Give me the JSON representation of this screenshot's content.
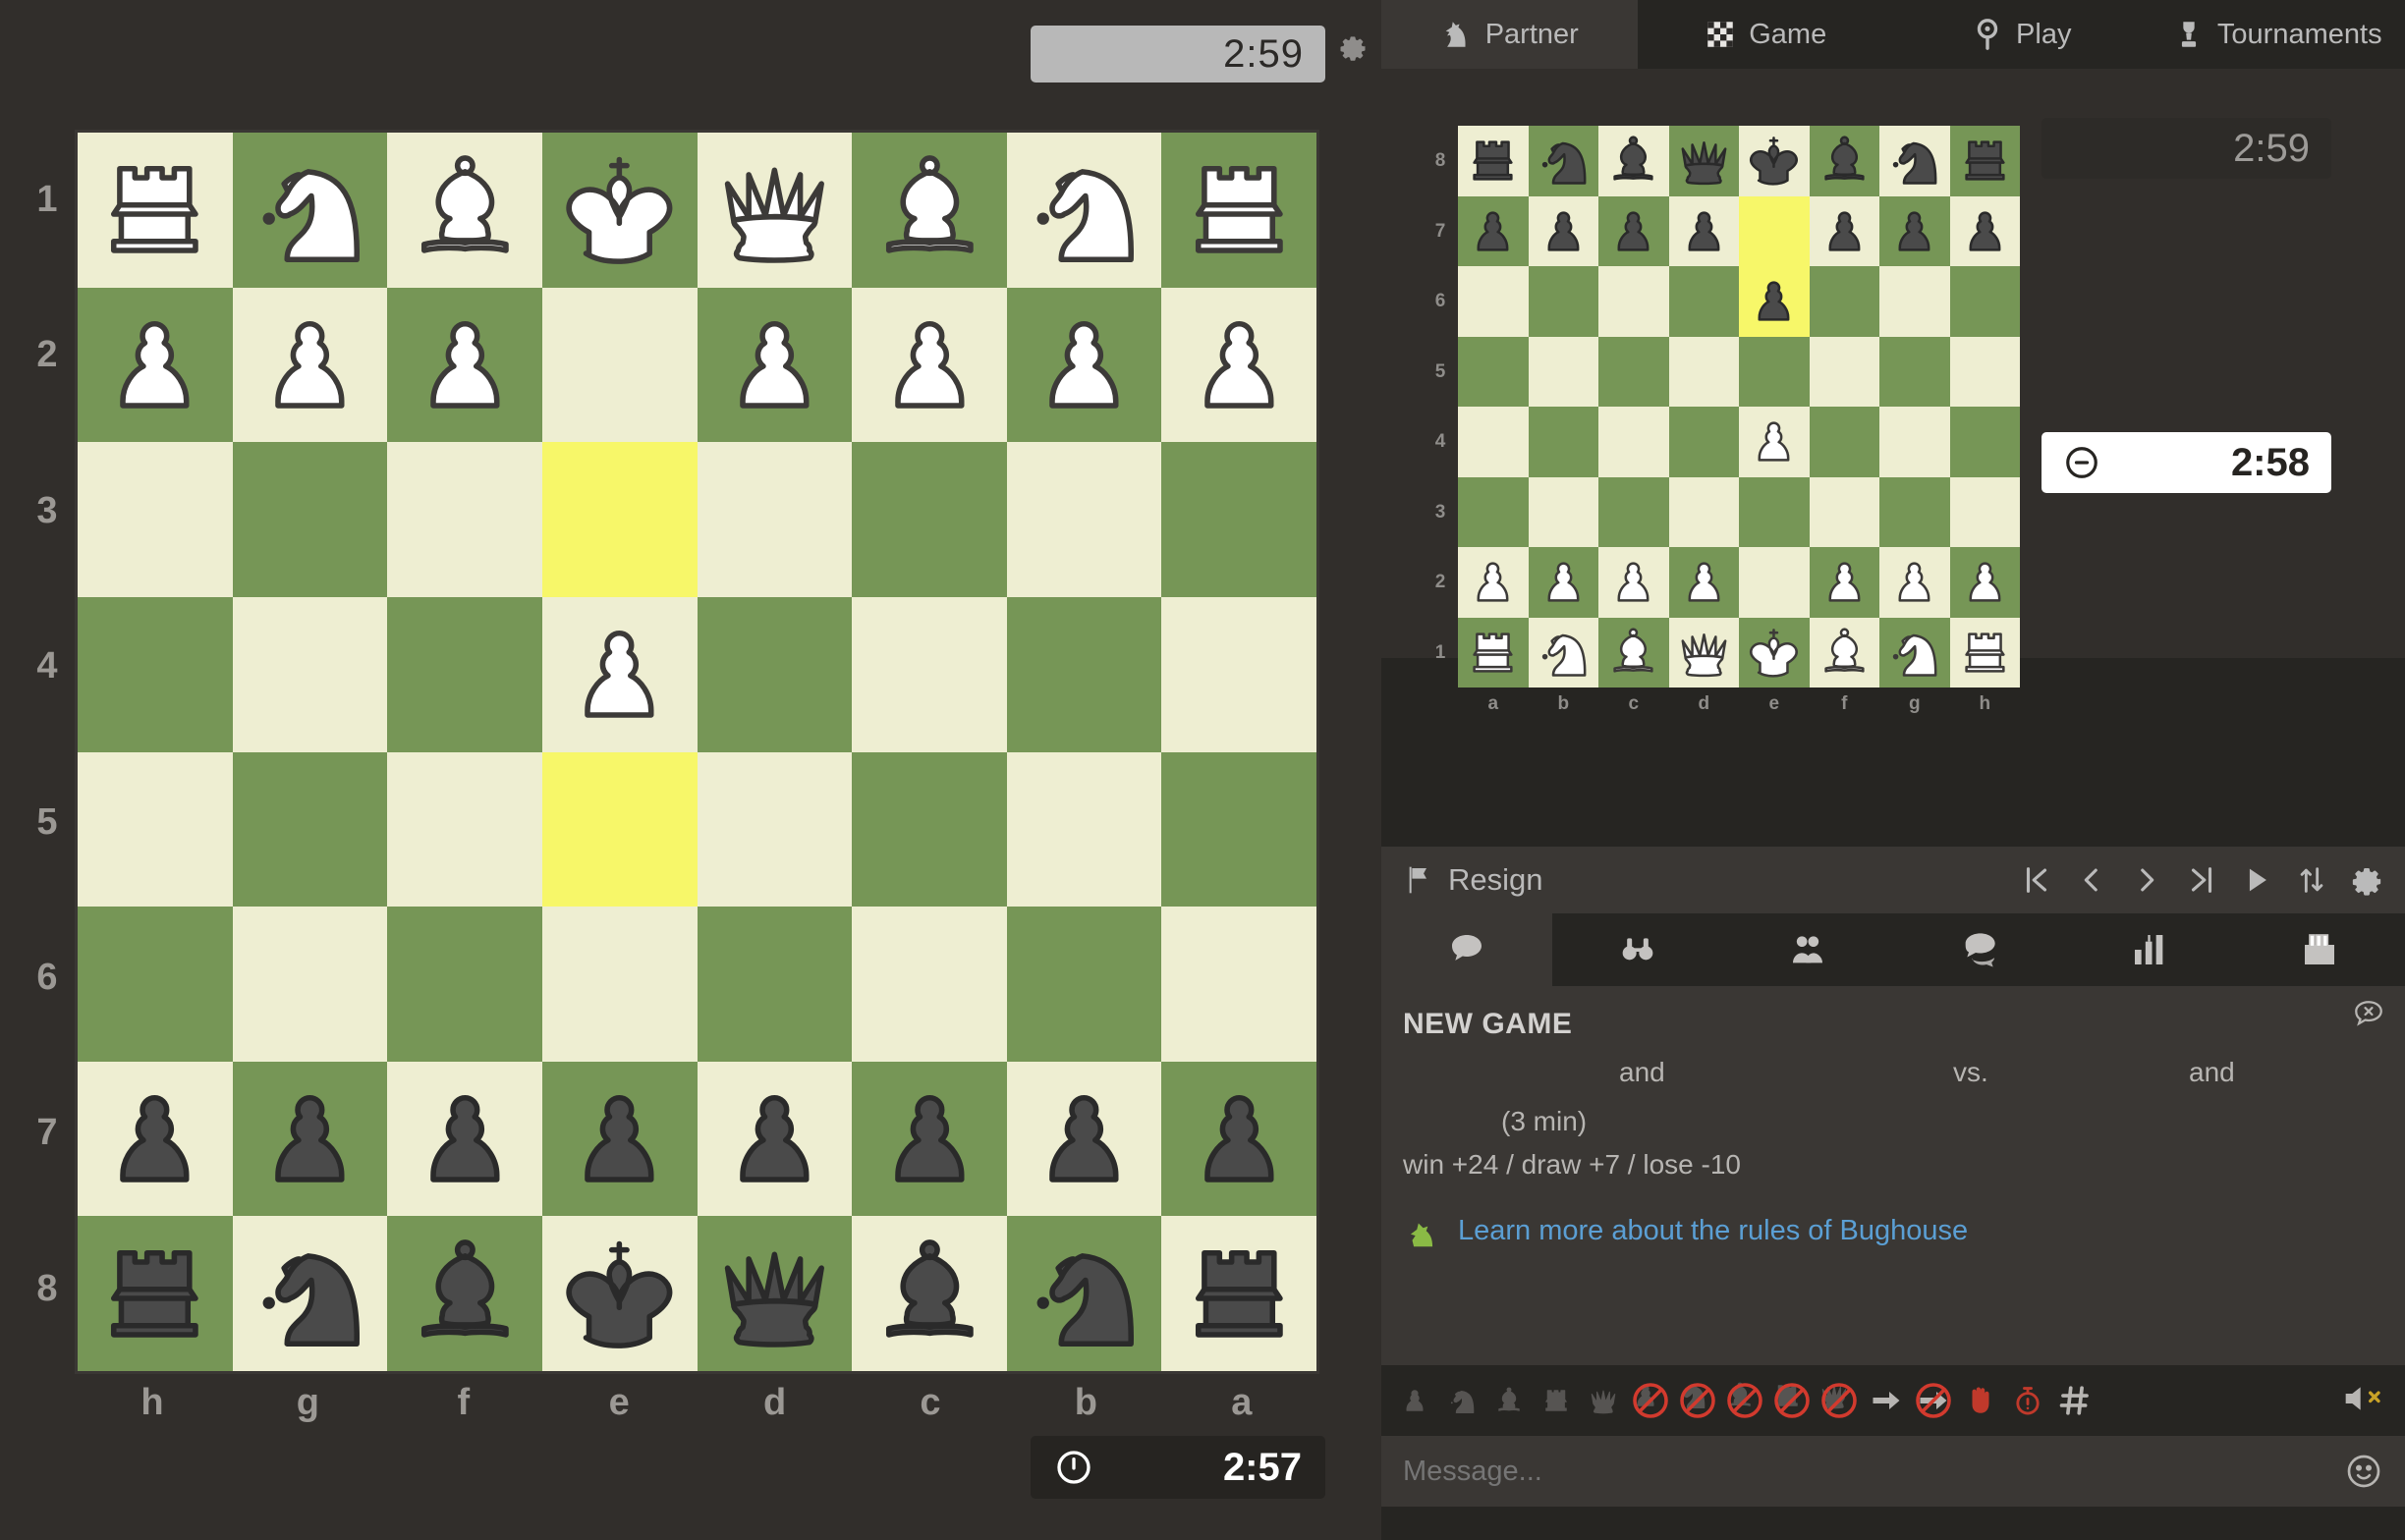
{
  "board": {
    "top_clock": "2:59",
    "bottom_clock": "2:57",
    "gear_icon": "gear-icon",
    "clock_icon": "clock-icon",
    "flipped": true,
    "rank_labels": [
      "1",
      "2",
      "3",
      "4",
      "5",
      "6",
      "7",
      "8"
    ],
    "file_labels": [
      "h",
      "g",
      "f",
      "e",
      "d",
      "c",
      "b",
      "a"
    ],
    "highlight_squares": [
      "r2c3",
      "r4c3"
    ],
    "rows": [
      [
        "wR",
        "wN",
        "wB",
        "wK",
        "wQ",
        "wB",
        "wN",
        "wR"
      ],
      [
        "wP",
        "wP",
        "wP",
        "",
        "wP",
        "wP",
        "wP",
        "wP"
      ],
      [
        "",
        "",
        "",
        "",
        "",
        "",
        "",
        ""
      ],
      [
        "",
        "",
        "",
        "wP",
        "",
        "",
        "",
        ""
      ],
      [
        "",
        "",
        "",
        "",
        "",
        "",
        "",
        ""
      ],
      [
        "",
        "",
        "",
        "",
        "",
        "",
        "",
        ""
      ],
      [
        "bP",
        "bP",
        "bP",
        "bP",
        "bP",
        "bP",
        "bP",
        "bP"
      ],
      [
        "bR",
        "bN",
        "bB",
        "bK",
        "bQ",
        "bB",
        "bN",
        "bR"
      ]
    ]
  },
  "tabs": [
    {
      "label": "Partner",
      "icon": "horse-head-icon",
      "active": true
    },
    {
      "label": "Game",
      "icon": "checkerboard-icon",
      "active": false
    },
    {
      "label": "Play",
      "icon": "play-pawn-icon",
      "active": false
    },
    {
      "label": "Tournaments",
      "icon": "trophy-icon",
      "active": false
    }
  ],
  "mini_board": {
    "top_clock": "2:59",
    "bottom_clock": "2:58",
    "bottom_clock_icon": "clock-minus-icon",
    "rank_labels": [
      "8",
      "7",
      "6",
      "5",
      "4",
      "3",
      "2",
      "1"
    ],
    "file_labels": [
      "a",
      "b",
      "c",
      "d",
      "e",
      "f",
      "g",
      "h"
    ],
    "highlight_squares": [
      "r1c4",
      "r2c4"
    ],
    "rows": [
      [
        "bR",
        "bN",
        "bB",
        "bQ",
        "bK",
        "bB",
        "bN",
        "bR"
      ],
      [
        "bP",
        "bP",
        "bP",
        "bP",
        "",
        "bP",
        "bP",
        "bP"
      ],
      [
        "",
        "",
        "",
        "",
        "bP",
        "",
        "",
        ""
      ],
      [
        "",
        "",
        "",
        "",
        "",
        "",
        "",
        ""
      ],
      [
        "",
        "",
        "",
        "",
        "wP",
        "",
        "",
        ""
      ],
      [
        "",
        "",
        "",
        "",
        "",
        "",
        "",
        ""
      ],
      [
        "wP",
        "wP",
        "wP",
        "wP",
        "",
        "wP",
        "wP",
        "wP"
      ],
      [
        "wR",
        "wN",
        "wB",
        "wQ",
        "wK",
        "wB",
        "wN",
        "wR"
      ]
    ]
  },
  "resign_bar": {
    "label": "Resign",
    "flag_icon": "flag-icon",
    "controls": [
      {
        "name": "first-move-button",
        "icon": "skip-to-start-icon"
      },
      {
        "name": "previous-move-button",
        "icon": "chevron-left-icon"
      },
      {
        "name": "next-move-button",
        "icon": "chevron-right-icon"
      },
      {
        "name": "last-move-button",
        "icon": "skip-to-end-icon"
      },
      {
        "name": "autoplay-button",
        "icon": "play-icon"
      },
      {
        "name": "flip-board-button",
        "icon": "flip-arrows-icon"
      },
      {
        "name": "settings-button",
        "icon": "gear-icon"
      }
    ]
  },
  "chat_tabs": [
    {
      "name": "chat-tab",
      "icon": "speech-bubble-icon",
      "active": true
    },
    {
      "name": "watchers-tab",
      "icon": "binoculars-icon",
      "active": false
    },
    {
      "name": "players-tab",
      "icon": "people-icon",
      "active": false
    },
    {
      "name": "messages-tab",
      "icon": "chat-bubbles-icon",
      "active": false
    },
    {
      "name": "stats-tab",
      "icon": "bar-chart-icon",
      "active": false
    },
    {
      "name": "archive-tab",
      "icon": "card-box-icon",
      "active": false
    }
  ],
  "chat": {
    "close_icon": "close-bubble-icon",
    "new_game_title": "NEW GAME",
    "player_and_1": "and",
    "player_vs": "vs.",
    "player_and_2": "and",
    "time_control": "(3 min)",
    "rating_change": "win +24 / draw +7 / lose -10",
    "bughouse_icon": "bughouse-knight-icon",
    "bughouse_link": "Learn more about the rules of Bughouse"
  },
  "emoji_bar": {
    "buttons": [
      {
        "name": "pawn-emoji",
        "icon": "pawn-icon"
      },
      {
        "name": "knight-emoji",
        "icon": "knight-icon"
      },
      {
        "name": "bishop-emoji",
        "icon": "bishop-icon"
      },
      {
        "name": "rook-emoji",
        "icon": "rook-icon"
      },
      {
        "name": "queen-emoji",
        "icon": "queen-icon"
      },
      {
        "name": "no-pawn-emoji",
        "icon": "pawn-blocked-icon"
      },
      {
        "name": "no-knight-emoji",
        "icon": "knight-blocked-icon"
      },
      {
        "name": "no-bishop-emoji",
        "icon": "bishop-blocked-icon"
      },
      {
        "name": "no-rook-emoji",
        "icon": "rook-blocked-icon"
      },
      {
        "name": "no-queen-emoji",
        "icon": "queen-blocked-icon"
      },
      {
        "name": "arrow-emoji",
        "icon": "arrow-right-icon"
      },
      {
        "name": "no-arrow-emoji",
        "icon": "arrow-blocked-icon"
      },
      {
        "name": "stop-emoji",
        "icon": "hand-stop-icon"
      },
      {
        "name": "hurry-emoji",
        "icon": "stopwatch-icon"
      },
      {
        "name": "mate-emoji",
        "icon": "hash-icon"
      }
    ],
    "mute_icon": "speaker-mute-icon"
  },
  "message_bar": {
    "placeholder": "Message...",
    "value": "",
    "emoji_icon": "smiley-icon"
  },
  "colors": {
    "board_light": "#eeeed2",
    "board_dark": "#769656",
    "highlight": "#f7f769",
    "panel_bg": "#262522",
    "chat_bg": "#3a3734",
    "link": "#5b9fd4",
    "page_bg": "#312e2b"
  }
}
